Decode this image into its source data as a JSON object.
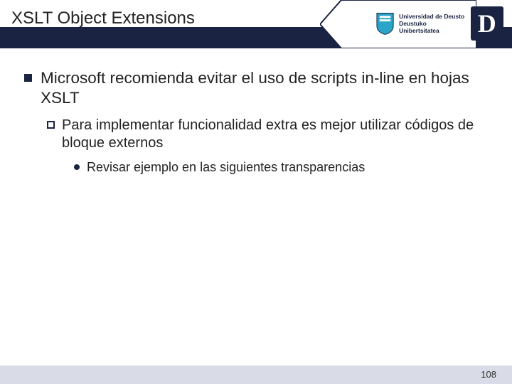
{
  "header": {
    "title": "XSLT Object Extensions",
    "logo": {
      "line1": "Universidad de Deusto",
      "line2": "Deustuko Unibertsitatea",
      "letter": "D"
    }
  },
  "content": {
    "l1": "Microsoft recomienda evitar el uso de scripts in-line en hojas XSLT",
    "l2": "Para implementar funcionalidad extra es mejor utilizar códigos de bloque externos",
    "l3": "Revisar ejemplo en las siguientes transparencias"
  },
  "footer": {
    "page": "108"
  },
  "colors": {
    "navy": "#1a2342",
    "footer": "#d9dbe6",
    "shield": "#2aa5c7"
  }
}
